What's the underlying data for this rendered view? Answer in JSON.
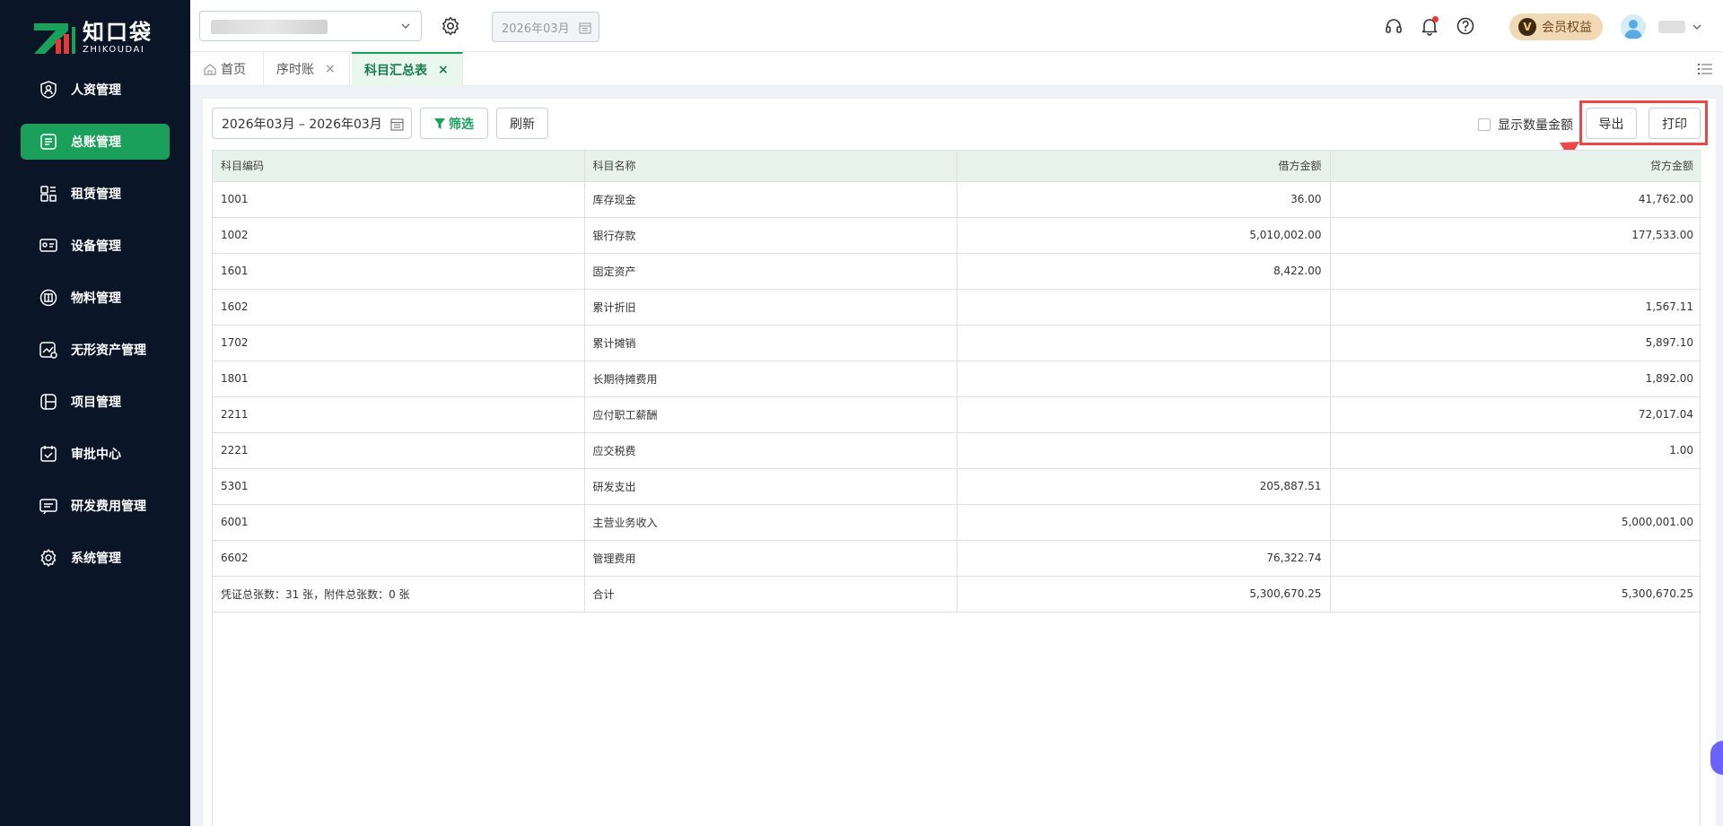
{
  "logo": {
    "cn": "知口袋",
    "en": "ZHIKOUDAI"
  },
  "sidebar": {
    "items": [
      {
        "label": "人资管理",
        "icon": "person-shield-icon",
        "active": false
      },
      {
        "label": "总账管理",
        "icon": "ledger-icon",
        "active": true
      },
      {
        "label": "租赁管理",
        "icon": "lease-icon",
        "active": false
      },
      {
        "label": "设备管理",
        "icon": "device-icon",
        "active": false
      },
      {
        "label": "物料管理",
        "icon": "box-icon",
        "active": false
      },
      {
        "label": "无形资产管理",
        "icon": "intangible-asset-icon",
        "active": false
      },
      {
        "label": "项目管理",
        "icon": "project-icon",
        "active": false
      },
      {
        "label": "审批中心",
        "icon": "approval-icon",
        "active": false
      },
      {
        "label": "研发费用管理",
        "icon": "rd-expense-icon",
        "active": false
      },
      {
        "label": "系统管理",
        "icon": "gear-icon",
        "active": false
      }
    ]
  },
  "header": {
    "period": "2026年03月",
    "vip_label": "会员权益",
    "vip_icon_letter": "V"
  },
  "tabs": [
    {
      "label": "首页",
      "closable": false,
      "active": false
    },
    {
      "label": "序时账",
      "closable": true,
      "active": false
    },
    {
      "label": "科目汇总表",
      "closable": true,
      "active": true
    }
  ],
  "tab_close_glyph": "×",
  "toolbar": {
    "date_range": "2026年03月 – 2026年03月",
    "filter_label": "筛选",
    "refresh_label": "刷新",
    "show_qty_label": "显示数量金额",
    "export_label": "导出",
    "print_label": "打印"
  },
  "table": {
    "columns": [
      "科目编码",
      "科目名称",
      "借方金额",
      "贷方金额"
    ],
    "rows": [
      [
        "1001",
        "库存现金",
        "36.00",
        "41,762.00"
      ],
      [
        "1002",
        "银行存款",
        "5,010,002.00",
        "177,533.00"
      ],
      [
        "1601",
        "固定资产",
        "8,422.00",
        ""
      ],
      [
        "1602",
        "累计折旧",
        "",
        "1,567.11"
      ],
      [
        "1702",
        "累计摊销",
        "",
        "5,897.10"
      ],
      [
        "1801",
        "长期待摊费用",
        "",
        "1,892.00"
      ],
      [
        "2211",
        "应付职工薪酬",
        "",
        "72,017.04"
      ],
      [
        "2221",
        "应交税费",
        "",
        "1.00"
      ],
      [
        "5301",
        "研发支出",
        "205,887.51",
        ""
      ],
      [
        "6001",
        "主营业务收入",
        "",
        "5,000,001.00"
      ],
      [
        "6602",
        "管理费用",
        "76,322.74",
        ""
      ],
      [
        "凭证总张数：31 张，附件总张数：0 张",
        "合计",
        "5,300,670.25",
        "5,300,670.25"
      ]
    ]
  },
  "colors": {
    "sidebar_bg": "#0a1628",
    "accent": "#1aa05a",
    "highlight": "#ea4748",
    "header_row_bg": "#e6f2eb"
  }
}
